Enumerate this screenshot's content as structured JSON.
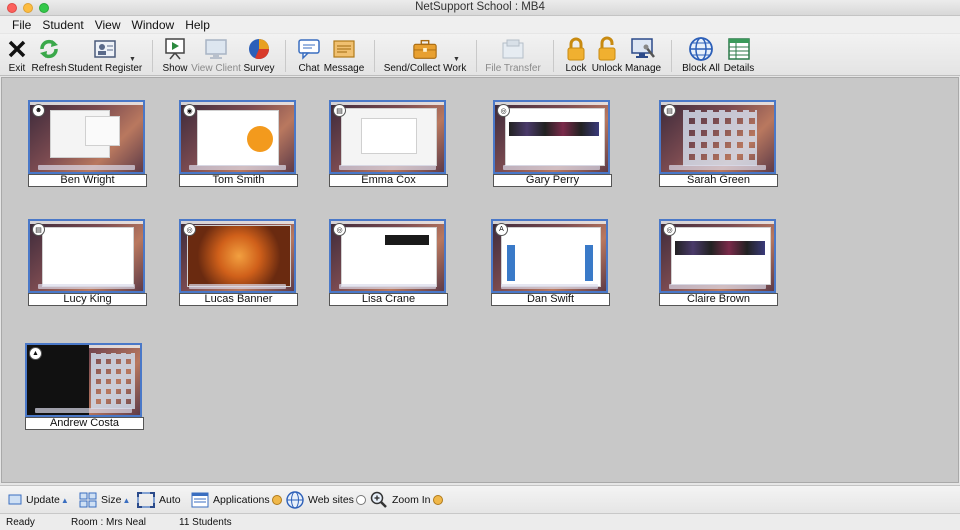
{
  "window": {
    "title": "NetSupport School : MB4"
  },
  "menu": [
    "File",
    "Student",
    "View",
    "Window",
    "Help"
  ],
  "toolbar": {
    "exit": "Exit",
    "refresh": "Refresh",
    "student_register": "Student Register",
    "show": "Show",
    "view_client": "View Client",
    "survey": "Survey",
    "chat": "Chat",
    "message": "Message",
    "send_collect": "Send/Collect Work",
    "file_transfer": "File Transfer",
    "lock": "Lock",
    "unlock": "Unlock",
    "manage": "Manage",
    "block_all": "Block All",
    "details": "Details"
  },
  "students": [
    {
      "name": "Ben Wright",
      "badge": "finder",
      "scene": "dialog"
    },
    {
      "name": "Tom Smith",
      "badge": "ibooks",
      "scene": "ibooks"
    },
    {
      "name": "Emma Cox",
      "badge": "notes",
      "scene": "browser"
    },
    {
      "name": "Gary Perry",
      "badge": "safari",
      "scene": "web-images"
    },
    {
      "name": "Sarah Green",
      "badge": "notes",
      "scene": "launchpad"
    },
    {
      "name": "Lucy King",
      "badge": "notes",
      "scene": "document"
    },
    {
      "name": "Lucas Banner",
      "badge": "safari",
      "scene": "sun"
    },
    {
      "name": "Lisa Crane",
      "badge": "safari",
      "scene": "article"
    },
    {
      "name": "Dan Swift",
      "badge": "appstore",
      "scene": "webpage"
    },
    {
      "name": "Claire Brown",
      "badge": "safari",
      "scene": "web-images"
    },
    {
      "name": "Andrew Costa",
      "badge": "keynote",
      "scene": "dark-launchpad"
    }
  ],
  "bottombar": {
    "update": "Update",
    "size": "Size",
    "auto": "Auto",
    "applications": "Applications",
    "websites": "Web sites",
    "zoom_in": "Zoom In"
  },
  "status": {
    "state": "Ready",
    "room": "Room : Mrs Neal",
    "count": "11 Students"
  }
}
